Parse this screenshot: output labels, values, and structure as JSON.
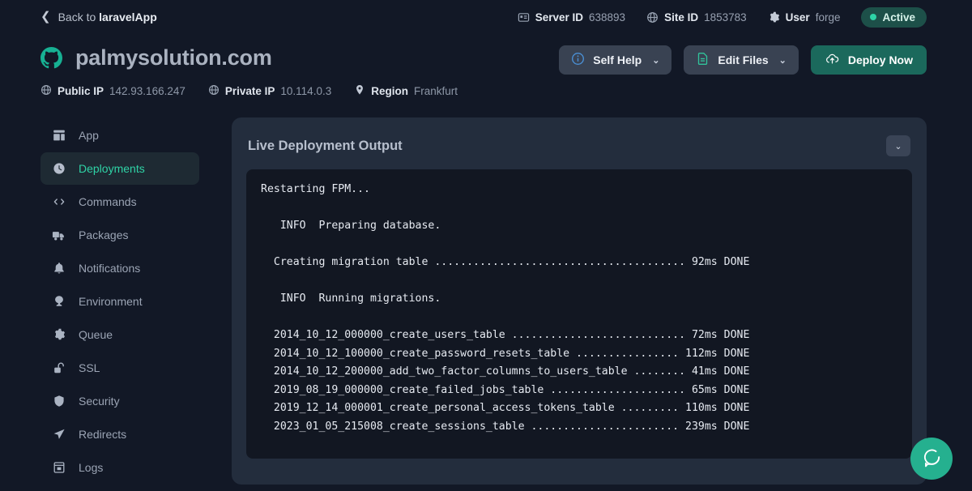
{
  "topbar": {
    "back_prefix": "Back to ",
    "back_app": "laravelApp",
    "meta": [
      {
        "icon": "server-icon",
        "key": "Server ID",
        "value": "638893"
      },
      {
        "icon": "globe-icon",
        "key": "Site ID",
        "value": "1853783"
      },
      {
        "icon": "gear-icon",
        "key": "User",
        "value": "forge"
      }
    ],
    "status": "Active"
  },
  "site": {
    "title": "palmysolution.com",
    "details": [
      {
        "icon": "globe-icon",
        "key": "Public IP",
        "value": "142.93.166.247"
      },
      {
        "icon": "globe-icon",
        "key": "Private IP",
        "value": "10.114.0.3"
      },
      {
        "icon": "pin-icon",
        "key": "Region",
        "value": "Frankfurt"
      }
    ]
  },
  "actions": {
    "self_help": "Self Help",
    "edit_files": "Edit Files",
    "deploy_now": "Deploy Now",
    "caret": "⌄"
  },
  "sidebar": {
    "items": [
      {
        "label": "App",
        "icon": "layout-icon",
        "active": false
      },
      {
        "label": "Deployments",
        "icon": "clock-icon",
        "active": true
      },
      {
        "label": "Commands",
        "icon": "code-icon",
        "active": false
      },
      {
        "label": "Packages",
        "icon": "truck-icon",
        "active": false
      },
      {
        "label": "Notifications",
        "icon": "bell-icon",
        "active": false
      },
      {
        "label": "Environment",
        "icon": "tree-icon",
        "active": false
      },
      {
        "label": "Queue",
        "icon": "gear-icon",
        "active": false
      },
      {
        "label": "SSL",
        "icon": "lock-open-icon",
        "active": false
      },
      {
        "label": "Security",
        "icon": "shield-icon",
        "active": false
      },
      {
        "label": "Redirects",
        "icon": "arrow-icon",
        "active": false
      },
      {
        "label": "Logs",
        "icon": "logs-icon",
        "active": false
      }
    ]
  },
  "panel": {
    "title": "Live Deployment Output",
    "collapse_glyph": "⌄",
    "terminal_lines": [
      "Restarting FPM...",
      "",
      "   INFO  Preparing database.",
      "",
      "  Creating migration table ....................................... 92ms DONE",
      "",
      "   INFO  Running migrations.",
      "",
      "  2014_10_12_000000_create_users_table ........................... 72ms DONE",
      "  2014_10_12_100000_create_password_resets_table ................ 112ms DONE",
      "  2014_10_12_200000_add_two_factor_columns_to_users_table ........ 41ms DONE",
      "  2019_08_19_000000_create_failed_jobs_table ..................... 65ms DONE",
      "  2019_12_14_000001_create_personal_access_tokens_table ......... 110ms DONE",
      "  2023_01_05_215008_create_sessions_table ....................... 239ms DONE"
    ]
  },
  "help": {
    "icon": "chat-help-icon"
  },
  "colors": {
    "background": "#121826",
    "panel": "#232d3d",
    "terminal": "#121722",
    "accent_teal": "#2fd3a6",
    "deploy_button": "#1b695c",
    "ghost_button": "#394252",
    "info_blue": "#4a8fd4",
    "help_bubble": "#25b08f"
  }
}
